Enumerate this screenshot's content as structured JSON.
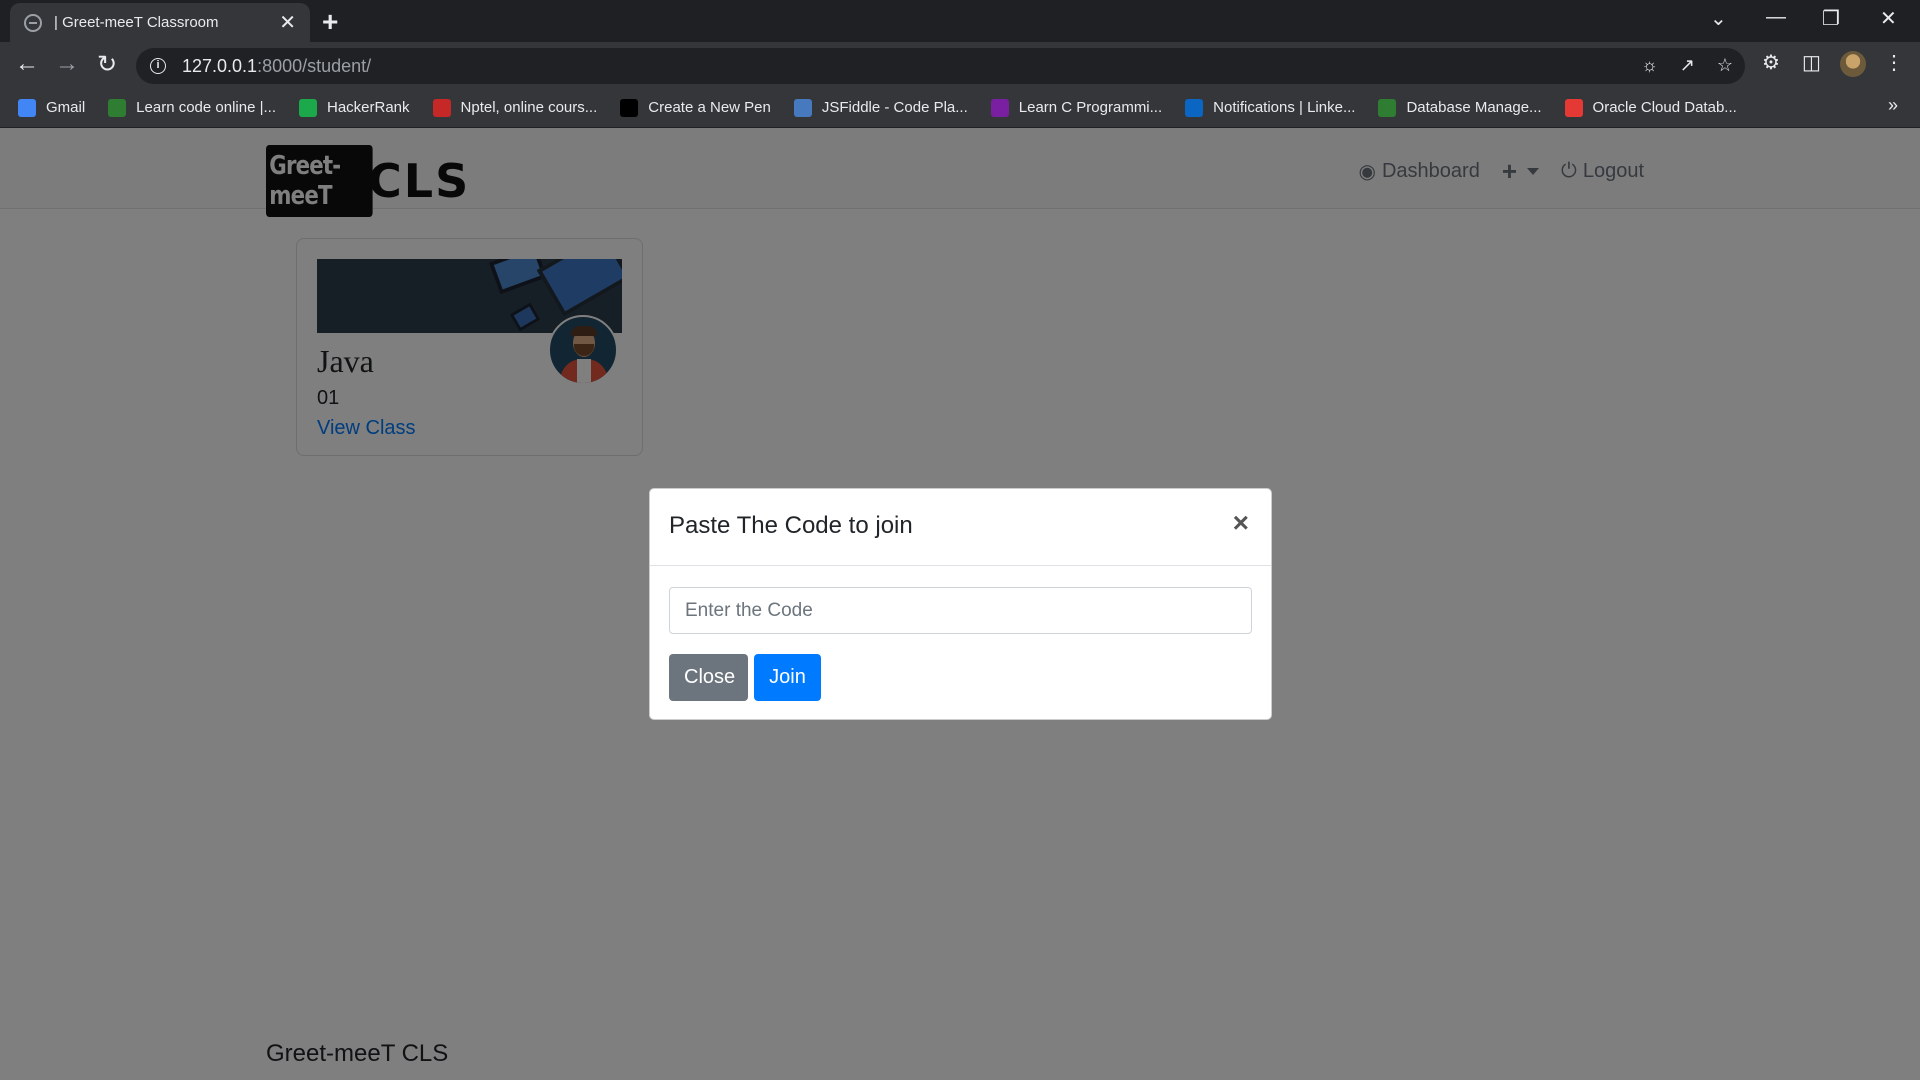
{
  "browser": {
    "tab_title": "| Greet-meeT Classroom",
    "tab_close": "✕",
    "new_tab": "+",
    "url_host": "127.0.0.1",
    "url_path": ":8000/student/",
    "bookmarks": [
      {
        "label": "Gmail",
        "icon": "google-icon",
        "color": "#4285f4"
      },
      {
        "label": "Learn code online |...",
        "icon": "learn-code-icon",
        "color": "#2e7d32"
      },
      {
        "label": "HackerRank",
        "icon": "hackerrank-icon",
        "color": "#1ba94c"
      },
      {
        "label": "Nptel, online cours...",
        "icon": "nptel-icon",
        "color": "#c62828"
      },
      {
        "label": "Create a New Pen",
        "icon": "codepen-icon",
        "color": "#000000"
      },
      {
        "label": "JSFiddle - Code Pla...",
        "icon": "jsfiddle-icon",
        "color": "#4679bd"
      },
      {
        "label": "Learn C Programmi...",
        "icon": "learn-c-icon",
        "color": "#7b1fa2"
      },
      {
        "label": "Notifications | Linke...",
        "icon": "linkedin-icon",
        "color": "#0a66c2"
      },
      {
        "label": "Database Manage...",
        "icon": "database-icon",
        "color": "#2e7d32"
      },
      {
        "label": "Oracle Cloud Datab...",
        "icon": "oracle-icon",
        "color": "#e53935"
      }
    ],
    "bookmarks_more": "»"
  },
  "navbar": {
    "brand_box": "Greet-meeT",
    "brand_cls": "CLS",
    "dashboard": "Dashboard",
    "plus": "+",
    "logout": "Logout"
  },
  "classes": [
    {
      "name": "Java",
      "code": "01",
      "link": "View Class"
    }
  ],
  "footer": {
    "text": "Greet-meeT CLS"
  },
  "modal": {
    "title": "Paste The Code to join",
    "close_x": "×",
    "input_placeholder": "Enter the Code",
    "input_value": "",
    "close_button": "Close",
    "join_button": "Join"
  },
  "colors": {
    "primary": "#007bff",
    "secondary": "#6c757d"
  }
}
